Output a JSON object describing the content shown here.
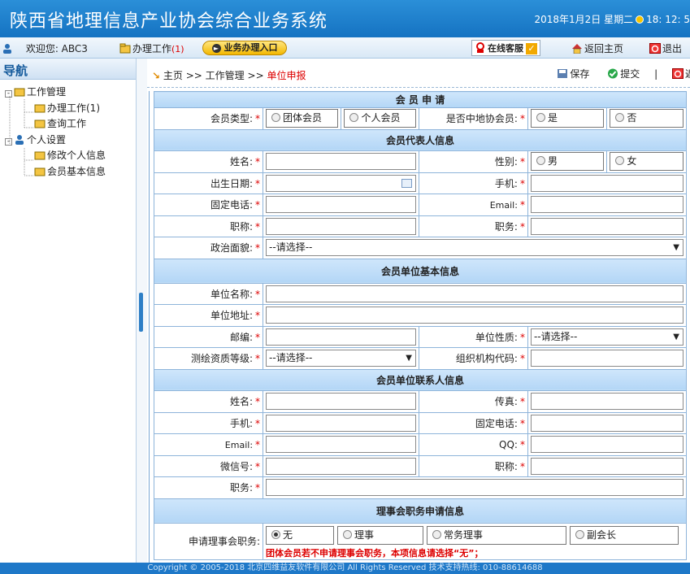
{
  "app": {
    "title": "陕西省地理信息产业协会综合业务系统",
    "datetime": "2018年1月2日 星期二",
    "time": "18: 12: 5"
  },
  "menubar": {
    "welcome": "欢迎您: ABC3",
    "work": "办理工作",
    "work_count": "(1)",
    "entry": "业务办理入口",
    "service": "在线客服",
    "home": "返回主页",
    "logout": "退出"
  },
  "sidebar": {
    "title": "导航",
    "tree": [
      {
        "label": "工作管理",
        "level": 0
      },
      {
        "label": "办理工作(1)",
        "level": 1
      },
      {
        "label": "查询工作",
        "level": 1
      },
      {
        "label": "个人设置",
        "level": 0
      },
      {
        "label": "修改个人信息",
        "level": 1
      },
      {
        "label": "会员基本信息",
        "level": 1
      }
    ]
  },
  "breadcrumb": {
    "home": "主页",
    "sep": ">>",
    "module": "工作管理",
    "current": "单位申报",
    "save": "保存",
    "submit": "提交",
    "back": "返"
  },
  "form": {
    "s1": "会 员 申 请",
    "member_type": {
      "label": "会员类型:",
      "opt1": "团体会员",
      "opt2": "个人会员"
    },
    "is_cn_member": {
      "label": "是否中地协会员:",
      "opt1": "是",
      "opt2": "否"
    },
    "s2": "会员代表人信息",
    "name": "姓名:",
    "gender": "性别:",
    "male": "男",
    "female": "女",
    "birth": "出生日期:",
    "mobile": "手机:",
    "phone": "固定电话:",
    "email": "Email:",
    "title_label": "职称:",
    "duty": "职务:",
    "politics": "政治面貌:",
    "select_placeholder": "--请选择--",
    "s3": "会员单位基本信息",
    "unit_name": "单位名称:",
    "unit_addr": "单位地址:",
    "zip": "邮编:",
    "unit_nature": "单位性质:",
    "qual_level": "测绘资质等级:",
    "org_code": "组织机构代码:",
    "s4": "会员单位联系人信息",
    "c_name": "姓名:",
    "fax": "传真:",
    "c_mobile": "手机:",
    "c_phone": "固定电话:",
    "c_email": "Email:",
    "qq": "QQ:",
    "wechat": "微信号:",
    "c_title": "职称:",
    "c_duty": "职务:",
    "s5": "理事会职务申请信息",
    "council": {
      "label": "申请理事会职务:",
      "opt1": "无",
      "opt2": "理事",
      "opt3": "常务理事",
      "opt4": "副会长"
    },
    "note": "团体会员若不申请理事会职务，本项信息请选择“无”；"
  },
  "footer": "Copyright © 2005-2018 北京四维益友软件有限公司 All Rights Reserved      技术支持热线: 010-88614688"
}
